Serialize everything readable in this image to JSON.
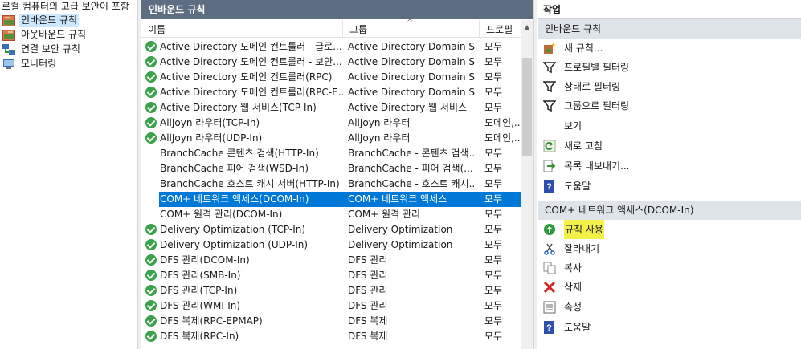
{
  "tree": {
    "root_label": "로컬 컴퓨터의 고급 보안이 포함",
    "items": [
      {
        "label": "인바운드 규칙",
        "icon": "inbound-rules-icon"
      },
      {
        "label": "아웃바운드 규칙",
        "icon": "outbound-rules-icon"
      },
      {
        "label": "연결 보안 규칙",
        "icon": "connection-security-icon"
      },
      {
        "label": "모니터링",
        "icon": "monitoring-icon"
      }
    ]
  },
  "center": {
    "title": "인바운드 규칙",
    "columns": {
      "name": "이름",
      "group": "그룹",
      "profile": "프로필"
    },
    "rows": [
      {
        "name": "Active Directory 도메인 컨트롤러 - 글로...",
        "group": "Active Directory Domain S...",
        "profile": "모두",
        "enabled": true
      },
      {
        "name": "Active Directory 도메인 컨트롤러 - 보안...",
        "group": "Active Directory Domain S...",
        "profile": "모두",
        "enabled": true
      },
      {
        "name": "Active Directory 도메인 컨트롤러(RPC)",
        "group": "Active Directory Domain S...",
        "profile": "모두",
        "enabled": true
      },
      {
        "name": "Active Directory 도메인 컨트롤러(RPC-E...",
        "group": "Active Directory Domain S...",
        "profile": "모두",
        "enabled": true
      },
      {
        "name": "Active Directory 웹 서비스(TCP-In)",
        "group": "Active Directory 웹 서비스",
        "profile": "모두",
        "enabled": true
      },
      {
        "name": "AllJoyn 라우터(TCP-In)",
        "group": "AllJoyn 라우터",
        "profile": "도메인,...",
        "enabled": true
      },
      {
        "name": "AllJoyn 라우터(UDP-In)",
        "group": "AllJoyn 라우터",
        "profile": "도메인,...",
        "enabled": true
      },
      {
        "name": "BranchCache 콘텐츠 검색(HTTP-In)",
        "group": "BranchCache - 콘텐츠 검색...",
        "profile": "모두",
        "enabled": false
      },
      {
        "name": "BranchCache 피어 검색(WSD-In)",
        "group": "BranchCache - 피어 검색(...",
        "profile": "모두",
        "enabled": false
      },
      {
        "name": "BranchCache 호스트 캐시 서버(HTTP-In)",
        "group": "BranchCache - 호스트 캐시...",
        "profile": "모두",
        "enabled": false
      },
      {
        "name": "COM+ 네트워크 액세스(DCOM-In)",
        "group": "COM+ 네트워크 액세스",
        "profile": "모두",
        "enabled": false,
        "selected": true
      },
      {
        "name": "COM+ 원격 관리(DCOM-In)",
        "group": "COM+ 원격 관리",
        "profile": "모두",
        "enabled": false
      },
      {
        "name": "Delivery Optimization (TCP-In)",
        "group": "Delivery Optimization",
        "profile": "모두",
        "enabled": true
      },
      {
        "name": "Delivery Optimization (UDP-In)",
        "group": "Delivery Optimization",
        "profile": "모두",
        "enabled": true
      },
      {
        "name": "DFS 관리(DCOM-In)",
        "group": "DFS 관리",
        "profile": "모두",
        "enabled": true
      },
      {
        "name": "DFS 관리(SMB-In)",
        "group": "DFS 관리",
        "profile": "모두",
        "enabled": true
      },
      {
        "name": "DFS 관리(TCP-In)",
        "group": "DFS 관리",
        "profile": "모두",
        "enabled": true
      },
      {
        "name": "DFS 관리(WMI-In)",
        "group": "DFS 관리",
        "profile": "모두",
        "enabled": true
      },
      {
        "name": "DFS 복제(RPC-EPMAP)",
        "group": "DFS 복제",
        "profile": "모두",
        "enabled": true
      },
      {
        "name": "DFS 복제(RPC-In)",
        "group": "DFS 복제",
        "profile": "모두",
        "enabled": true
      }
    ]
  },
  "actions": {
    "header": "작업",
    "section1_title": "인바운드 규칙",
    "section1_items": [
      {
        "label": "새 규칙...",
        "icon": "new-rule-icon"
      },
      {
        "label": "프로필별 필터링",
        "icon": "filter-icon"
      },
      {
        "label": "상태로 필터링",
        "icon": "filter-icon"
      },
      {
        "label": "그룹으로 필터링",
        "icon": "filter-icon"
      },
      {
        "label": "보기",
        "icon": "none"
      },
      {
        "label": "새로 고침",
        "icon": "refresh-icon"
      },
      {
        "label": "목록 내보내기...",
        "icon": "export-icon"
      },
      {
        "label": "도움말",
        "icon": "help-icon"
      }
    ],
    "section2_title": "COM+ 네트워크 액세스(DCOM-In)",
    "section2_items": [
      {
        "label": "규칙 사용",
        "icon": "enable-rule-icon",
        "highlight": true
      },
      {
        "label": "잘라내기",
        "icon": "cut-icon"
      },
      {
        "label": "복사",
        "icon": "copy-icon"
      },
      {
        "label": "삭제",
        "icon": "delete-icon"
      },
      {
        "label": "속성",
        "icon": "properties-icon"
      },
      {
        "label": "도움말",
        "icon": "help-icon"
      }
    ]
  },
  "colors": {
    "title_bar": "#5e6e82",
    "selection": "#0078d7",
    "enabled_check": "#3aa24a",
    "section_bg": "#dfe4ea",
    "highlight": "#f3f04a"
  }
}
